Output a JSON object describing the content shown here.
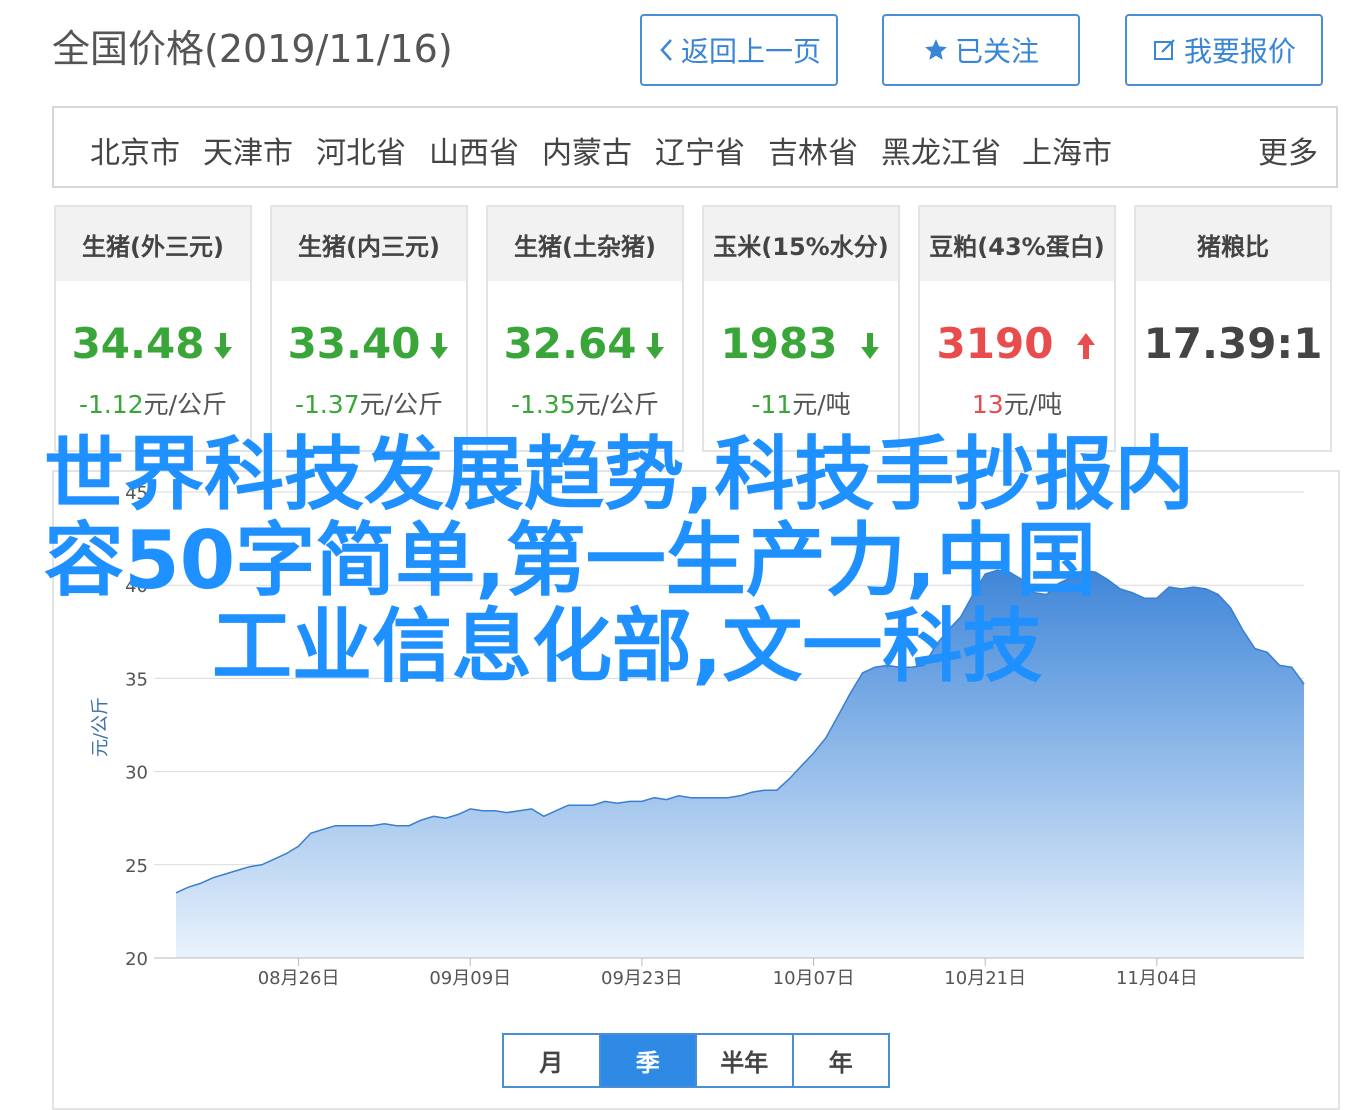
{
  "header": {
    "title": "全国价格(2019/11/16)",
    "back_label": "返回上一页",
    "follow_label": "已关注",
    "report_label": "我要报价"
  },
  "provinces": [
    "北京市",
    "天津市",
    "河北省",
    "山西省",
    "内蒙古",
    "辽宁省",
    "吉林省",
    "黑龙江省",
    "上海市"
  ],
  "more_label": "更多",
  "cards": [
    {
      "title": "生猪(外三元)",
      "value": "34.48",
      "trend": "down",
      "change": "-1.12",
      "unit": "元/公斤"
    },
    {
      "title": "生猪(内三元)",
      "value": "33.40",
      "trend": "down",
      "change": "-1.37",
      "unit": "元/公斤"
    },
    {
      "title": "生猪(土杂猪)",
      "value": "32.64",
      "trend": "down",
      "change": "-1.35",
      "unit": "元/公斤"
    },
    {
      "title": "玉米(15%水分)",
      "value": "1983",
      "trend": "down",
      "change": "-11",
      "unit": "元/吨"
    },
    {
      "title": "豆粕(43%蛋白)",
      "value": "3190",
      "trend": "up",
      "change": "13",
      "unit": "元/吨"
    },
    {
      "title": "猪粮比",
      "value": "17.39:1",
      "trend": "none",
      "change": "",
      "unit": ""
    }
  ],
  "colors": {
    "accent": "#2f8ae6",
    "down": "#3aa63a",
    "up": "#e84c4c",
    "overlay_text": "#1e90ff"
  },
  "overlay": {
    "line1": "世界科技发展趋势,科技手抄报内",
    "line2": "容50字简单,第一生产力,中国",
    "line3": "工业信息化部,文一科技"
  },
  "range_tabs": [
    "月",
    "季",
    "半年",
    "年"
  ],
  "active_range": "季",
  "chart_data": {
    "type": "area",
    "ylabel": "元/公斤",
    "ylim": [
      20,
      45
    ],
    "yticks": [
      20,
      25,
      30,
      35,
      40,
      45
    ],
    "xtick_labels": [
      "08月26日",
      "09月09日",
      "09月23日",
      "10月07日",
      "10月21日",
      "11月04日"
    ],
    "xtick_index": [
      10,
      24,
      38,
      52,
      66,
      80
    ],
    "values": [
      23.5,
      23.8,
      24.0,
      24.3,
      24.5,
      24.7,
      24.9,
      25.0,
      25.3,
      25.6,
      26.0,
      26.7,
      26.9,
      27.1,
      27.1,
      27.1,
      27.1,
      27.2,
      27.1,
      27.1,
      27.4,
      27.6,
      27.5,
      27.7,
      28.0,
      27.9,
      27.9,
      27.8,
      27.9,
      28.0,
      27.6,
      27.9,
      28.2,
      28.2,
      28.2,
      28.4,
      28.3,
      28.4,
      28.4,
      28.6,
      28.5,
      28.7,
      28.6,
      28.6,
      28.6,
      28.6,
      28.7,
      28.9,
      29.0,
      29.0,
      29.6,
      30.3,
      31.0,
      31.8,
      33.0,
      34.2,
      35.3,
      35.6,
      35.7,
      35.6,
      35.6,
      35.7,
      36.8,
      37.6,
      38.3,
      39.5,
      40.6,
      40.8,
      40.7,
      40.3,
      39.6,
      39.5,
      40.1,
      40.4,
      40.8,
      40.7,
      40.3,
      39.8,
      39.6,
      39.3,
      39.3,
      39.9,
      39.8,
      39.9,
      39.8,
      39.5,
      38.8,
      37.6,
      36.6,
      36.4,
      35.7,
      35.6,
      34.7
    ]
  }
}
